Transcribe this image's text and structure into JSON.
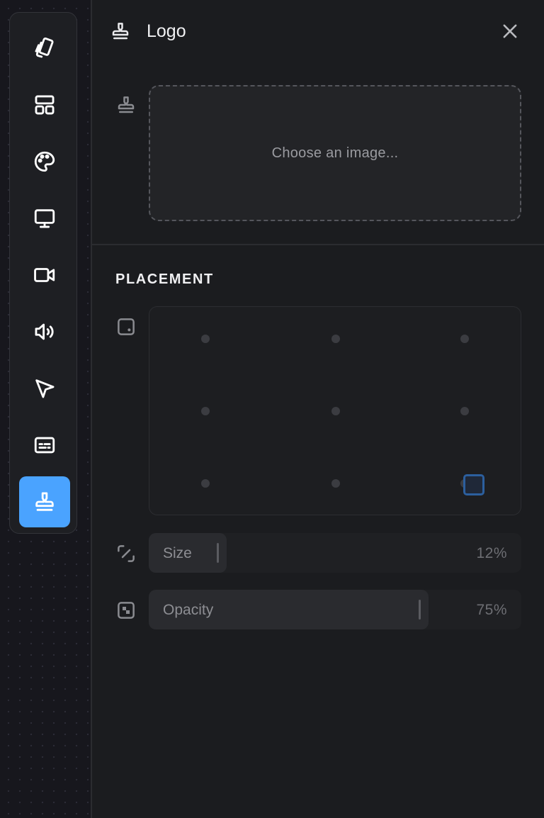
{
  "sidebar": {
    "tools": [
      {
        "icon": "cards-icon"
      },
      {
        "icon": "layout-icon"
      },
      {
        "icon": "palette-icon"
      },
      {
        "icon": "monitor-icon"
      },
      {
        "icon": "video-camera-icon"
      },
      {
        "icon": "speaker-icon"
      },
      {
        "icon": "cursor-pointer-icon"
      },
      {
        "icon": "captions-icon"
      },
      {
        "icon": "stamp-icon",
        "active": true
      }
    ],
    "accent_color": "#4aa3ff"
  },
  "panel": {
    "title": "Logo",
    "title_icon": "stamp-icon",
    "upload": {
      "placeholder": "Choose an image..."
    },
    "placement": {
      "heading": "PLACEMENT",
      "positions": [
        "top-left",
        "top-center",
        "top-right",
        "middle-left",
        "center",
        "middle-right",
        "bottom-left",
        "bottom-center",
        "bottom-right"
      ],
      "selected": "bottom-right"
    },
    "size": {
      "label": "Size",
      "value": "12%",
      "fraction": 0.12
    },
    "opacity": {
      "label": "Opacity",
      "value": "75%",
      "fraction": 0.75
    }
  }
}
